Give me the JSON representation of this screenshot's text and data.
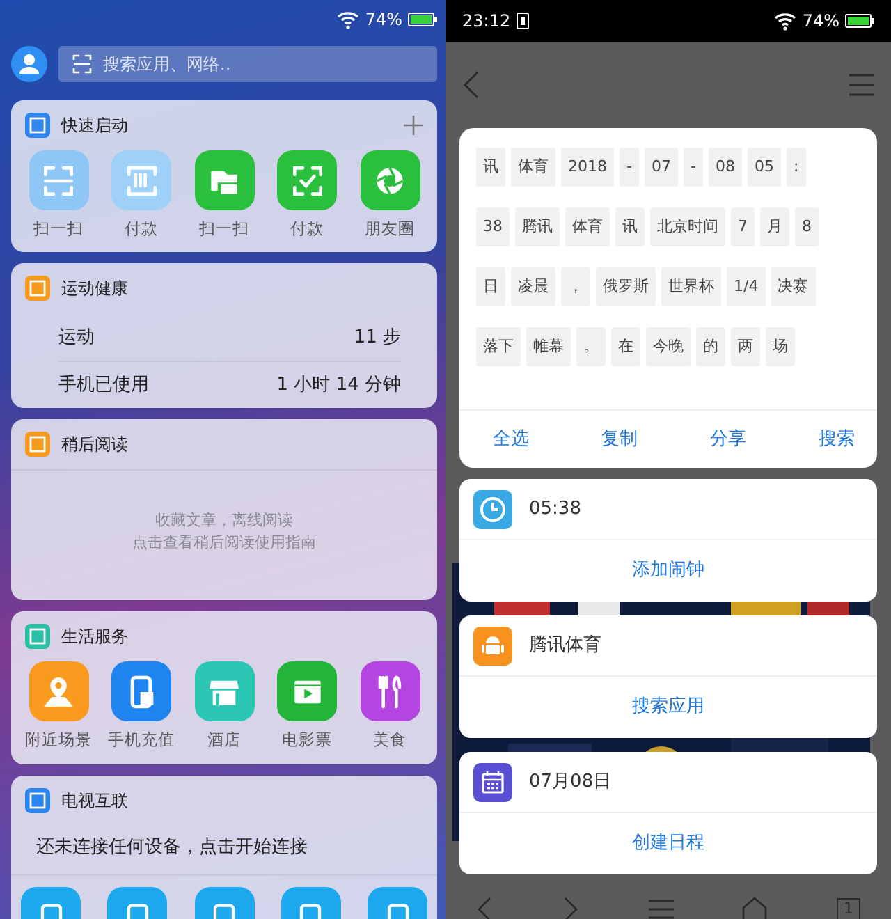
{
  "home_screen": {
    "status_bar": {
      "battery": "74%"
    },
    "search": {
      "placeholder": "搜索应用、网络.."
    },
    "cards": [
      {
        "kind": "apps",
        "title": "快速启动",
        "color": "#2f86ee",
        "apps": [
          {
            "label": "扫一扫",
            "color": "#8ec6f6"
          },
          {
            "label": "付款",
            "color": "#9fd0f7"
          },
          {
            "label": "扫一扫",
            "color": "#2bbf3e"
          },
          {
            "label": "付款",
            "color": "#2bbf3e"
          },
          {
            "label": "朋友圈",
            "color": "#2bbf3e"
          }
        ]
      },
      {
        "kind": "stats",
        "title": "运动健康",
        "color": "#f59a1c",
        "rows": [
          {
            "label": "运动",
            "value": "11 步"
          },
          {
            "label": "手机已使用",
            "value": "1 小时 14 分钟"
          }
        ]
      },
      {
        "kind": "message",
        "title": "稍后阅读",
        "color": "#f59a1c",
        "lines": [
          "收藏文章，离线阅读",
          "点击查看稍后阅读使用指南"
        ]
      },
      {
        "kind": "apps",
        "title": "生活服务",
        "color": "#2bbfa8",
        "apps": [
          {
            "label": "附近场景",
            "color": "#fa9a1e"
          },
          {
            "label": "手机充值",
            "color": "#1f84f0"
          },
          {
            "label": "酒店",
            "color": "#2cc6b4"
          },
          {
            "label": "电影票",
            "color": "#23b43a"
          },
          {
            "label": "美食",
            "color": "#b545e0"
          }
        ]
      },
      {
        "kind": "connect",
        "title": "电视互联",
        "color": "#2a86ee",
        "text": "还未连接任何设备，点击开始连接",
        "devices": [
          {
            "color": "#1ea8ee"
          },
          {
            "color": "#1ea8ee"
          },
          {
            "color": "#1ea8ee"
          },
          {
            "color": "#1ea8ee"
          },
          {
            "color": "#1ea8ee"
          }
        ]
      }
    ]
  },
  "reader": {
    "status_bar": {
      "time": "23:12",
      "battery": "74%"
    },
    "selection": {
      "chips": [
        [
          "讯",
          "体育",
          "2018",
          "-",
          "07",
          "-",
          "08",
          "05",
          ":"
        ],
        [
          "38",
          "腾讯",
          "体育",
          "讯",
          "北京时间",
          "7",
          "月",
          "8"
        ],
        [
          "日",
          "凌晨",
          "，",
          "俄罗斯",
          "世界杯",
          "1/4",
          "决赛"
        ],
        [
          "落下",
          "帷幕",
          "。",
          "在",
          "今晚",
          "的",
          "两",
          "场"
        ]
      ],
      "actions": [
        "全选",
        "复制",
        "分享",
        "搜索"
      ]
    },
    "suggestions": [
      {
        "kind": "clock",
        "text": "05:38",
        "action": "添加闹钟"
      },
      {
        "kind": "app",
        "text": "腾讯体育",
        "action": "搜索应用"
      },
      {
        "kind": "calendar",
        "text": "07月08日",
        "action": "创建日程"
      }
    ],
    "tab_count": "1"
  }
}
